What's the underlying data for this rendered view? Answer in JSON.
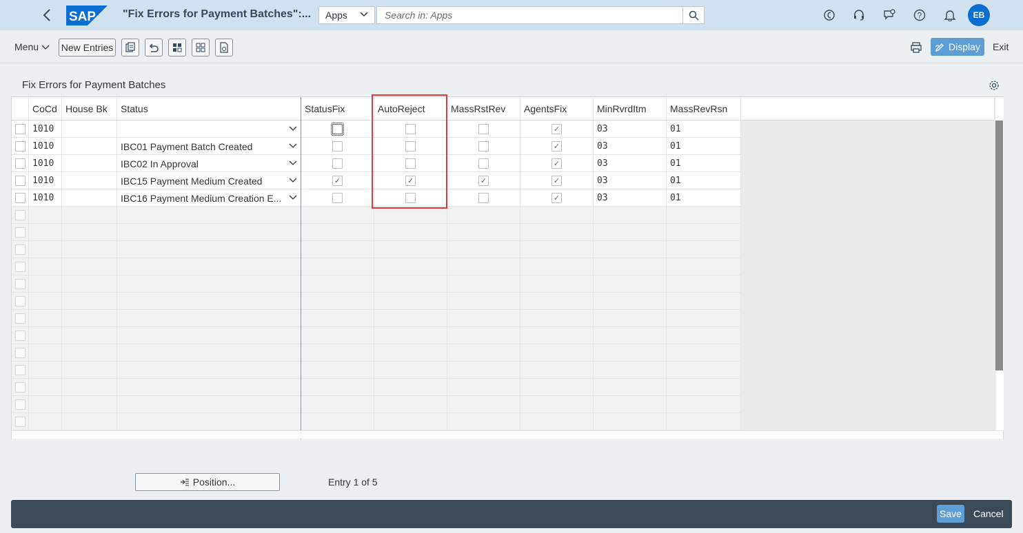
{
  "shell": {
    "title": "\"Fix Errors for Payment Batches\":...",
    "apps_select": "Apps",
    "search_placeholder": "Search in: Apps",
    "avatar_initials": "EB",
    "brand_color": "#0a6ed1"
  },
  "toolbar": {
    "menu_label": "Menu",
    "new_entries_label": "New Entries",
    "display_label": "Display",
    "exit_label": "Exit"
  },
  "panel": {
    "title": "Fix Errors for Payment Batches"
  },
  "table": {
    "columns": [
      "CoCd",
      "House Bk",
      "Status",
      "StatusFix",
      "AutoReject",
      "MassRstRev",
      "AgentsFix",
      "MinRvrdItm",
      "MassRevRsn"
    ],
    "rows": [
      {
        "cocd": "1010",
        "house_bk": "",
        "status": "",
        "status_fix": false,
        "auto_reject": false,
        "mass_rst_rev": false,
        "agents_fix": true,
        "min_rvrd_itm": "03",
        "mass_rev_rsn": "01"
      },
      {
        "cocd": "1010",
        "house_bk": "",
        "status": "IBC01 Payment Batch Created",
        "status_fix": false,
        "auto_reject": false,
        "mass_rst_rev": false,
        "agents_fix": true,
        "min_rvrd_itm": "03",
        "mass_rev_rsn": "01"
      },
      {
        "cocd": "1010",
        "house_bk": "",
        "status": "IBC02 In Approval",
        "status_fix": false,
        "auto_reject": false,
        "mass_rst_rev": false,
        "agents_fix": true,
        "min_rvrd_itm": "03",
        "mass_rev_rsn": "01"
      },
      {
        "cocd": "1010",
        "house_bk": "",
        "status": "IBC15 Payment Medium Created",
        "status_fix": true,
        "auto_reject": true,
        "mass_rst_rev": true,
        "agents_fix": true,
        "min_rvrd_itm": "03",
        "mass_rev_rsn": "01"
      },
      {
        "cocd": "1010",
        "house_bk": "",
        "status": "IBC16 Payment Medium Creation E...",
        "status_fix": false,
        "auto_reject": false,
        "mass_rst_rev": false,
        "agents_fix": true,
        "min_rvrd_itm": "03",
        "mass_rev_rsn": "01"
      }
    ],
    "empty_row_count": 13,
    "highlight_color": "#e03c3c"
  },
  "footer": {
    "position_label": "Position...",
    "entry_text": "Entry 1 of 5",
    "save_label": "Save",
    "cancel_label": "Cancel"
  }
}
